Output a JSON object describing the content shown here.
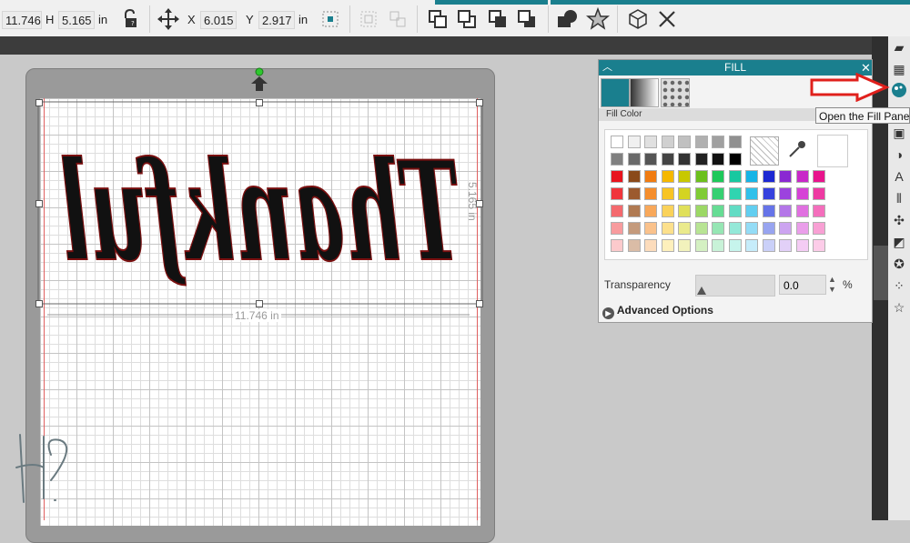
{
  "toolbar": {
    "width_value": "11.746",
    "height_label": "H",
    "height_value": "5.165",
    "unit": "in",
    "x_label": "X",
    "x_value": "6.015",
    "y_label": "Y",
    "y_value": "2.917",
    "y_unit": "in"
  },
  "canvas": {
    "width_dimension": "11.746 in",
    "height_dimension": "5.165 in",
    "design_text": "Thankful"
  },
  "fill_panel": {
    "title": "FILL",
    "fill_color_label": "Fill Color",
    "transparency_label": "Transparency",
    "transparency_value": "0.0",
    "transparency_unit": "%",
    "advanced_label": "Advanced Options",
    "accent_color": "#1a7f8e",
    "swatches": [
      [
        "#ffffff",
        "#f0f0f0",
        "#e0e0e0",
        "#d0d0d0",
        "#c0c0c0",
        "#b0b0b0",
        "#a0a0a0",
        "#909090"
      ],
      [
        "#808080",
        "#6a6a6a",
        "#555555",
        "#444444",
        "#333333",
        "#222222",
        "#111111",
        "#000000"
      ],
      [
        "#e8141e",
        "#8a4a1a",
        "#f07c12",
        "#f5b800",
        "#c8c800",
        "#6cc01e",
        "#1ec85a",
        "#18c8a0",
        "#16b4e6",
        "#1c28d2",
        "#8a28d2",
        "#c828c8",
        "#e8148c"
      ],
      [
        "#f0363c",
        "#9c5a2e",
        "#f58e2c",
        "#f8c424",
        "#d4d422",
        "#80cc36",
        "#36d072",
        "#30d4b0",
        "#30c0ea",
        "#3642de",
        "#9c42de",
        "#d642d6",
        "#ee3aa2"
      ],
      [
        "#f46a6e",
        "#b07a52",
        "#f8a85a",
        "#fad25a",
        "#e0e05a",
        "#9cd866",
        "#66dc94",
        "#62dcc4",
        "#62cef0",
        "#6674e8",
        "#b476e8",
        "#e070e0",
        "#f46ebc"
      ],
      [
        "#f89c9e",
        "#c49a7c",
        "#fac28c",
        "#fce08c",
        "#eaea8c",
        "#b8e494",
        "#96e6b4",
        "#94e8d8",
        "#94dcf6",
        "#98a4f0",
        "#cca4f0",
        "#ea9eea",
        "#f8a0d4"
      ],
      [
        "#fccacc",
        "#dabca6",
        "#fcdcbc",
        "#fef0bc",
        "#f2f2bc",
        "#d4f0c2",
        "#c8f2d8",
        "#c6f4ec",
        "#c6ecfa",
        "#cad0f8",
        "#e2d0f8",
        "#f4ccf4",
        "#fccce8"
      ]
    ]
  },
  "tooltip": {
    "text": "Open the Fill Panel"
  },
  "sidebar_icons": [
    "page-setup-icon",
    "pixscan-icon",
    "fill-icon",
    "line-icon",
    "shadow-icon",
    "text-icon",
    "align-icon",
    "replicate-icon",
    "modify-icon",
    "offset-icon",
    "trace-icon",
    "star-icon"
  ]
}
